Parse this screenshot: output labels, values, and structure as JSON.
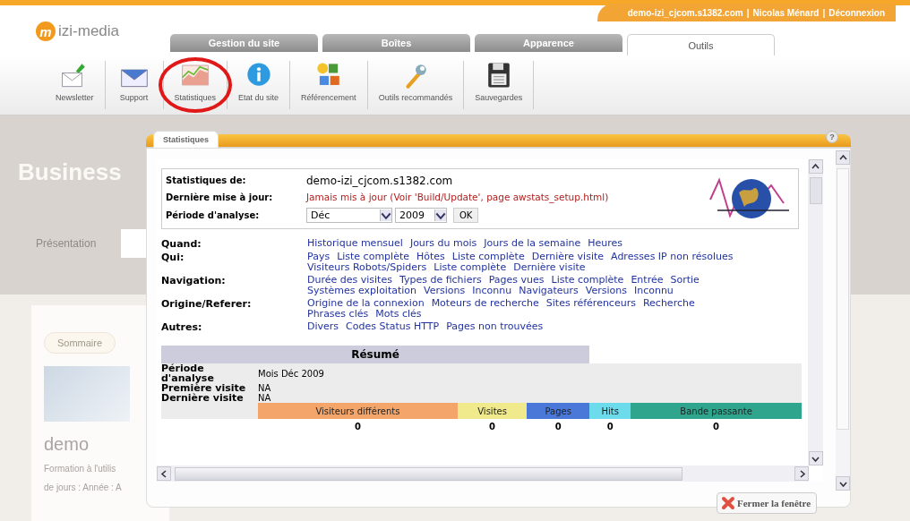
{
  "header": {
    "logo": {
      "mark": "m",
      "text": "izi-media"
    },
    "user_links": [
      "demo-izi_cjcom.s1382.com",
      "Nicolas Ménard",
      "Déconnexion"
    ],
    "separator": "|"
  },
  "tabs": [
    {
      "label": "Gestion du site",
      "selected": false
    },
    {
      "label": "Boîtes",
      "selected": false
    },
    {
      "label": "Apparence",
      "selected": false
    },
    {
      "label": "Outils",
      "selected": true
    }
  ],
  "toolbar": [
    {
      "label": "Newsletter",
      "highlighted": false
    },
    {
      "label": "Support",
      "highlighted": false
    },
    {
      "label": "Statistiques",
      "highlighted": true
    },
    {
      "label": "Etat du site",
      "highlighted": false
    },
    {
      "label": "Référencement",
      "highlighted": false
    },
    {
      "label": "Outils recommandés",
      "highlighted": false
    },
    {
      "label": "Sauvegardes",
      "highlighted": false
    }
  ],
  "background_page": {
    "title": "Business",
    "menu_item": "Présentation",
    "card": {
      "button": "Sommaire",
      "title": "demo",
      "lines": [
        "Formation à l'utilis",
        "de jours : Année : A"
      ]
    }
  },
  "dialog": {
    "tab": "Statistiques",
    "help": "?",
    "info": [
      {
        "label": "Statistiques de:",
        "value": "demo-izi_cjcom.s1382.com",
        "kind": "text"
      },
      {
        "label": "Dernière mise à jour:",
        "value": "Jamais mis à jour (Voir 'Build/Update', page awstats_setup.html)",
        "kind": "warning"
      },
      {
        "label": "Période d'analyse:",
        "kind": "period",
        "month": "Déc",
        "year": "2009",
        "button": "OK"
      }
    ],
    "nav": [
      {
        "label": "Quand:",
        "links": [
          "Historique mensuel",
          "Jours du mois",
          "Jours de la semaine",
          "Heures"
        ]
      },
      {
        "label": "Qui:",
        "links": [
          "Pays",
          "Liste complète",
          "Hôtes",
          "Liste complète",
          "Dernière visite",
          "Adresses IP non résolues",
          "Visiteurs Robots/Spiders",
          "Liste complète",
          "Dernière visite"
        ]
      },
      {
        "label": "Navigation:",
        "links": [
          "Durée des visites",
          "Types de fichiers",
          "Pages vues",
          "Liste complète",
          "Entrée",
          "Sortie",
          "Systèmes exploitation",
          "Versions",
          "Inconnu",
          "Navigateurs",
          "Versions",
          "Inconnu"
        ]
      },
      {
        "label": "Origine/Referer:",
        "links": [
          "Origine de la connexion",
          "Moteurs de recherche",
          "Sites référenceurs",
          "Recherche",
          "Phrases clés",
          "Mots clés"
        ]
      },
      {
        "label": "Autres:",
        "links": [
          "Divers",
          "Codes Status HTTP",
          "Pages non trouvées"
        ]
      }
    ],
    "summary": {
      "title": "Résumé",
      "rows": [
        {
          "label": "Période d'analyse",
          "value": "Mois Déc 2009"
        },
        {
          "label": "Première visite",
          "value": "NA"
        },
        {
          "label": "Dernière visite",
          "value": "NA"
        }
      ],
      "metrics": [
        {
          "label": "Visiteurs différents",
          "color": "#f4a56a",
          "value": "0"
        },
        {
          "label": "Visites",
          "color": "#f0ea8c",
          "value": "0"
        },
        {
          "label": "Pages",
          "color": "#4a78d8",
          "value": "0"
        },
        {
          "label": "Hits",
          "color": "#6cdcec",
          "value": "0"
        },
        {
          "label": "Bande passante",
          "color": "#2fa58e",
          "value": "0"
        }
      ]
    },
    "close_button": "Fermer la fenêtre"
  }
}
